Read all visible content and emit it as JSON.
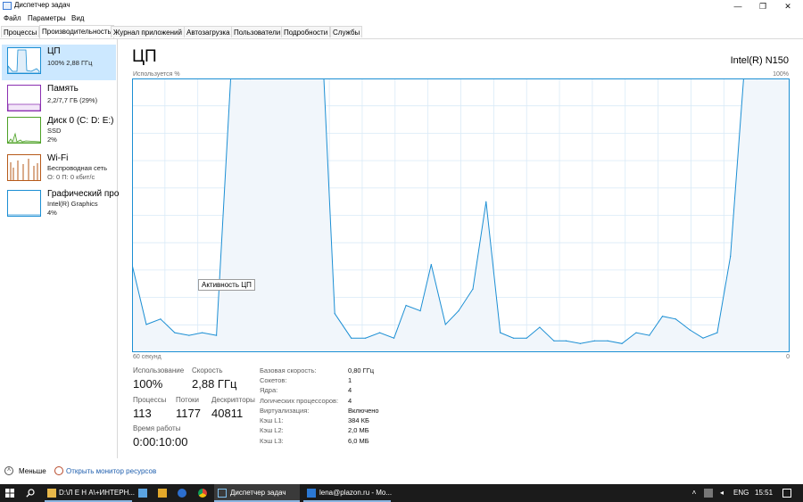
{
  "window": {
    "title": "Диспетчер задач",
    "minimize": "—",
    "maximize": "❐",
    "close": "✕"
  },
  "menu": [
    "Файл",
    "Параметры",
    "Вид"
  ],
  "tabs": [
    "Процессы",
    "Производительность",
    "Журнал приложений",
    "Автозагрузка",
    "Пользователи",
    "Подробности",
    "Службы"
  ],
  "active_tab": "Производительность",
  "sidebar": {
    "items": [
      {
        "name": "ЦП",
        "sub1": "100% 2,88 ГГц",
        "sub2": "",
        "color": "#1c8fd4",
        "selected": true
      },
      {
        "name": "Память",
        "sub1": "2,2/7,7 ГБ (29%)",
        "sub2": "",
        "color": "#8b2fb1",
        "selected": false
      },
      {
        "name": "Диск 0 (C: D: E:)",
        "sub1": "SSD",
        "sub2": "2%",
        "color": "#4da126",
        "selected": false
      },
      {
        "name": "Wi-Fi",
        "sub1": "Беспроводная сеть",
        "sub2": "О: 0 П: 0 кбит/с",
        "color": "#b65a1a",
        "selected": false
      },
      {
        "name": "Графический про",
        "sub1": "Intel(R) Graphics",
        "sub2": "4%",
        "color": "#1c8fd4",
        "selected": false
      }
    ]
  },
  "cpu": {
    "heading": "ЦП",
    "model": "Intel(R) N150",
    "usage_caption": "Используется %",
    "usage_max": "100%",
    "axis_left": "60 секунд",
    "axis_right": "0",
    "tooltip": "Активность ЦП",
    "line_color": "#1c8fd4",
    "fill_color": "#f1f6fb",
    "grid_color": "#d9eaf7"
  },
  "chart_data": {
    "type": "area",
    "ylim": [
      0,
      100
    ],
    "xlim": [
      60,
      0
    ],
    "x": [
      60,
      58.7,
      57.4,
      56.1,
      54.8,
      53.6,
      52.3,
      51,
      49.7,
      49.2,
      42.5,
      41.5,
      40,
      38.7,
      37.4,
      36.1,
      35,
      33.7,
      32.7,
      31.4,
      30.2,
      28.9,
      27.7,
      26.4,
      25.2,
      24,
      22.8,
      21.5,
      20.4,
      19.1,
      17.8,
      16.6,
      15.3,
      14,
      12.8,
      11.6,
      10.4,
      9.1,
      7.9,
      6.6,
      5.4,
      4.2,
      3,
      0.5,
      0
    ],
    "values": [
      32,
      10,
      12,
      7,
      6,
      7,
      6,
      100,
      100,
      100,
      100,
      14,
      5,
      5,
      7,
      5,
      17,
      15,
      32,
      10,
      15,
      23,
      55,
      7,
      5,
      5,
      9,
      4,
      4,
      3,
      4,
      4,
      3,
      7,
      6,
      13,
      12,
      8,
      5,
      7,
      35,
      100,
      100,
      100,
      100
    ]
  },
  "stats": {
    "utilization": {
      "label": "Использование",
      "value": "100%"
    },
    "speed": {
      "label": "Скорость",
      "value": "2,88 ГГц"
    },
    "processes": {
      "label": "Процессы",
      "value": "113"
    },
    "threads": {
      "label": "Потоки",
      "value": "1177"
    },
    "handles": {
      "label": "Дескрипторы",
      "value": "40811"
    },
    "uptime": {
      "label": "Время работы",
      "value": "0:00:10:00"
    }
  },
  "specs": [
    {
      "label": "Базовая скорость:",
      "value": "0,80 ГГц"
    },
    {
      "label": "Сокетов:",
      "value": "1"
    },
    {
      "label": "Ядра:",
      "value": "4"
    },
    {
      "label": "Логических процессоров:",
      "value": "4"
    },
    {
      "label": "Виртуализация:",
      "value": "Включено"
    },
    {
      "label": "Кэш L1:",
      "value": "384 КБ"
    },
    {
      "label": "Кэш L2:",
      "value": "2,0 МБ"
    },
    {
      "label": "Кэш L3:",
      "value": "6,0 МБ"
    }
  ],
  "footer": {
    "fewer": "Меньше",
    "monitor": "Открыть монитор ресурсов"
  },
  "taskbar": {
    "explorer_label": "D:\\Л Е Н А\\+ИНТЕРН...",
    "taskmgr_label": "Диспетчер задач",
    "mail_label": "lena@plazon.ru - Mo...",
    "lang": "ENG",
    "time": "15:51"
  }
}
